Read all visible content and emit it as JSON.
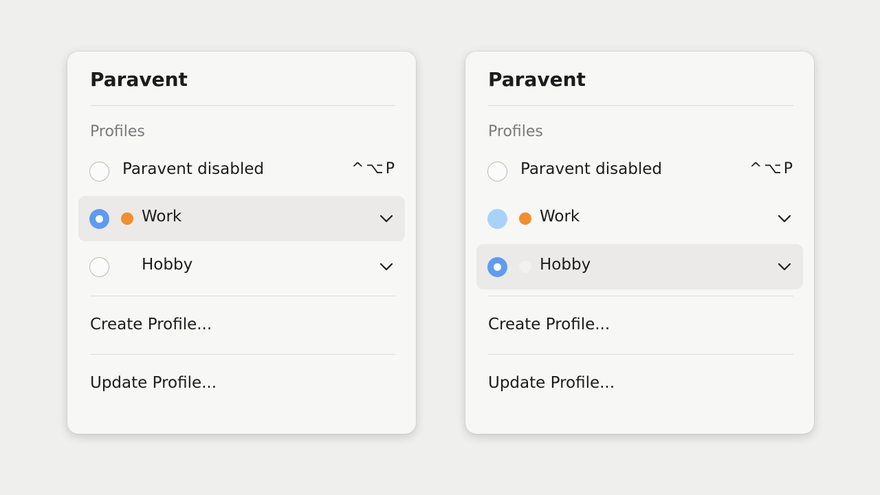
{
  "menus": [
    {
      "title": "Paravent",
      "section_label": "Profiles",
      "rows": [
        {
          "label": "Paravent disabled",
          "shortcut": "^⌥P",
          "state": "unselected"
        },
        {
          "label": "Work",
          "dot_color": "#f08e30",
          "state": "selected",
          "highlighted": true
        },
        {
          "label": "Hobby",
          "state": "unselected"
        }
      ],
      "actions": [
        "Create Profile...",
        "Update Profile..."
      ]
    },
    {
      "title": "Paravent",
      "section_label": "Profiles",
      "rows": [
        {
          "label": "Paravent disabled",
          "shortcut": "^⌥P",
          "state": "unselected"
        },
        {
          "label": "Work",
          "dot_color": "#f08e30",
          "state": "pressed"
        },
        {
          "label": "Hobby",
          "dot_color": "#f2f1f0",
          "state": "selected",
          "highlighted": true
        }
      ],
      "actions": [
        "Create Profile...",
        "Update Profile..."
      ]
    }
  ],
  "colors": {
    "accent": "#5d9cf0",
    "accent_light": "#a8d2fb",
    "work_dot": "#f08e30",
    "highlight": "#ebeae8",
    "background": "#efefed",
    "panel": "#f7f7f6"
  },
  "icons": {
    "chevron": "chevron-down-icon",
    "radio": "radio-button-icon"
  }
}
